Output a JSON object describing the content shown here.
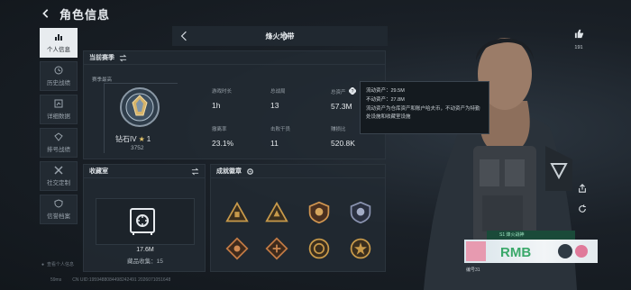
{
  "header": {
    "title": "角色信息"
  },
  "nav": [
    {
      "label": "个人信息",
      "icon": "bar-chart-icon",
      "active": true
    },
    {
      "label": "历史战绩",
      "icon": "history-icon",
      "active": false
    },
    {
      "label": "详细数据",
      "icon": "data-icon",
      "active": false
    },
    {
      "label": "排号战绩",
      "icon": "rank-record-icon",
      "active": false
    },
    {
      "label": "社交定制",
      "icon": "tools-icon",
      "active": false
    },
    {
      "label": "信誉档案",
      "icon": "shield-icon",
      "active": false
    }
  ],
  "nav_footer": "查看个人信息",
  "season_selector": {
    "name": "烽火地带"
  },
  "season_panel": {
    "title": "当前赛季",
    "rank_label": "赛季最高",
    "rank_name": "钻石IV",
    "rank_stars": "1",
    "rank_score": "3752",
    "stats": [
      {
        "label": "游戏时长",
        "value": "1h"
      },
      {
        "label": "总战局",
        "value": "13"
      },
      {
        "label": "总资产",
        "value": "57.3M"
      },
      {
        "label": "撤离率",
        "value": "23.1%"
      },
      {
        "label": "击败干员",
        "value": "11"
      },
      {
        "label": "赚损比",
        "value": "520.8K"
      }
    ]
  },
  "tooltip": {
    "liquid": "流动资产：29.5M",
    "fixed": "不动资产：27.8M",
    "note": "流动资产为仓库资产和账户哈夫币，不动资产为特勤处设施和收藏室设施"
  },
  "collection": {
    "title": "收藏室",
    "value": "17.6M",
    "count_label": "藏品收集：15"
  },
  "badges": {
    "title": "成就徽章"
  },
  "likes": {
    "count": "191"
  },
  "profile_card": {
    "tag": "S1 烽火战神",
    "name": "编号31"
  },
  "footer": {
    "ping": "59ms",
    "uid": "CN UID:1959488084498242491 2026071051648"
  },
  "colors": {
    "accent_active": "#e8ecef",
    "panel_bg": "#222a32",
    "badge_gold": "#c89a4a"
  }
}
